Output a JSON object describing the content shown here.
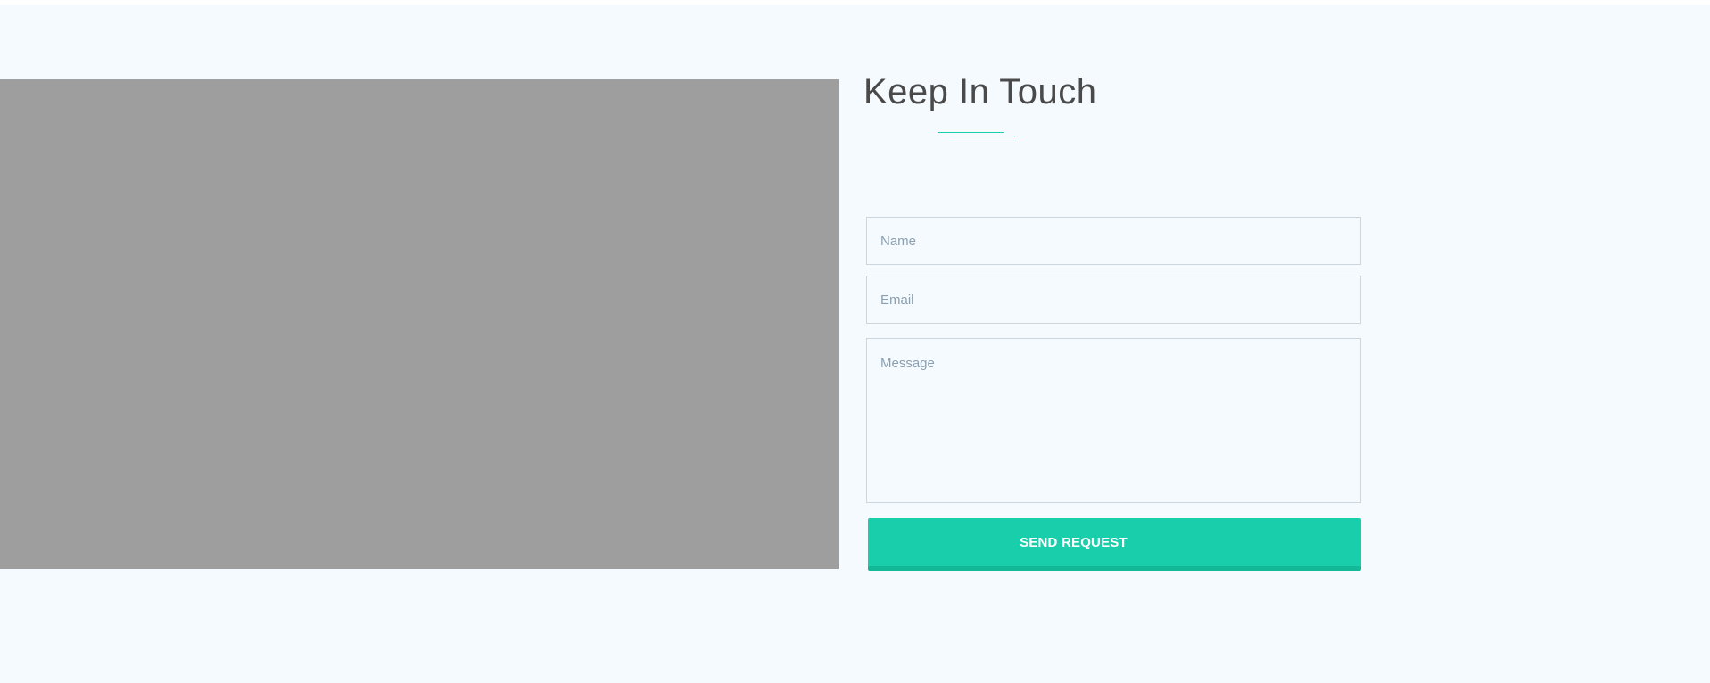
{
  "contact": {
    "title": "Keep In Touch",
    "name_placeholder": "Name",
    "email_placeholder": "Email",
    "message_placeholder": "Message",
    "submit_label": "SEND REQUEST"
  },
  "colors": {
    "accent": "#19cfab",
    "accent_dark": "#13b897",
    "background": "#f5faff",
    "map_placeholder": "#9e9e9e",
    "title_text": "#4a4a4a",
    "placeholder_text": "#8aa0b0",
    "field_border": "#ccd6de"
  }
}
